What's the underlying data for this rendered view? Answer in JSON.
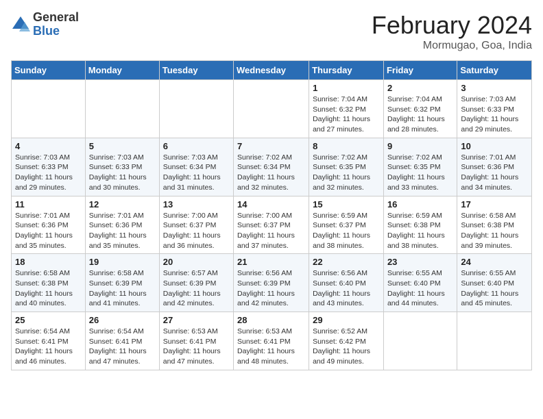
{
  "header": {
    "logo_general": "General",
    "logo_blue": "Blue",
    "title": "February 2024",
    "subtitle": "Mormugao, Goa, India"
  },
  "days_of_week": [
    "Sunday",
    "Monday",
    "Tuesday",
    "Wednesday",
    "Thursday",
    "Friday",
    "Saturday"
  ],
  "weeks": [
    [
      {
        "day": "",
        "info": ""
      },
      {
        "day": "",
        "info": ""
      },
      {
        "day": "",
        "info": ""
      },
      {
        "day": "",
        "info": ""
      },
      {
        "day": "1",
        "info": "Sunrise: 7:04 AM\nSunset: 6:32 PM\nDaylight: 11 hours and 27 minutes."
      },
      {
        "day": "2",
        "info": "Sunrise: 7:04 AM\nSunset: 6:32 PM\nDaylight: 11 hours and 28 minutes."
      },
      {
        "day": "3",
        "info": "Sunrise: 7:03 AM\nSunset: 6:33 PM\nDaylight: 11 hours and 29 minutes."
      }
    ],
    [
      {
        "day": "4",
        "info": "Sunrise: 7:03 AM\nSunset: 6:33 PM\nDaylight: 11 hours and 29 minutes."
      },
      {
        "day": "5",
        "info": "Sunrise: 7:03 AM\nSunset: 6:33 PM\nDaylight: 11 hours and 30 minutes."
      },
      {
        "day": "6",
        "info": "Sunrise: 7:03 AM\nSunset: 6:34 PM\nDaylight: 11 hours and 31 minutes."
      },
      {
        "day": "7",
        "info": "Sunrise: 7:02 AM\nSunset: 6:34 PM\nDaylight: 11 hours and 32 minutes."
      },
      {
        "day": "8",
        "info": "Sunrise: 7:02 AM\nSunset: 6:35 PM\nDaylight: 11 hours and 32 minutes."
      },
      {
        "day": "9",
        "info": "Sunrise: 7:02 AM\nSunset: 6:35 PM\nDaylight: 11 hours and 33 minutes."
      },
      {
        "day": "10",
        "info": "Sunrise: 7:01 AM\nSunset: 6:36 PM\nDaylight: 11 hours and 34 minutes."
      }
    ],
    [
      {
        "day": "11",
        "info": "Sunrise: 7:01 AM\nSunset: 6:36 PM\nDaylight: 11 hours and 35 minutes."
      },
      {
        "day": "12",
        "info": "Sunrise: 7:01 AM\nSunset: 6:36 PM\nDaylight: 11 hours and 35 minutes."
      },
      {
        "day": "13",
        "info": "Sunrise: 7:00 AM\nSunset: 6:37 PM\nDaylight: 11 hours and 36 minutes."
      },
      {
        "day": "14",
        "info": "Sunrise: 7:00 AM\nSunset: 6:37 PM\nDaylight: 11 hours and 37 minutes."
      },
      {
        "day": "15",
        "info": "Sunrise: 6:59 AM\nSunset: 6:37 PM\nDaylight: 11 hours and 38 minutes."
      },
      {
        "day": "16",
        "info": "Sunrise: 6:59 AM\nSunset: 6:38 PM\nDaylight: 11 hours and 38 minutes."
      },
      {
        "day": "17",
        "info": "Sunrise: 6:58 AM\nSunset: 6:38 PM\nDaylight: 11 hours and 39 minutes."
      }
    ],
    [
      {
        "day": "18",
        "info": "Sunrise: 6:58 AM\nSunset: 6:38 PM\nDaylight: 11 hours and 40 minutes."
      },
      {
        "day": "19",
        "info": "Sunrise: 6:58 AM\nSunset: 6:39 PM\nDaylight: 11 hours and 41 minutes."
      },
      {
        "day": "20",
        "info": "Sunrise: 6:57 AM\nSunset: 6:39 PM\nDaylight: 11 hours and 42 minutes."
      },
      {
        "day": "21",
        "info": "Sunrise: 6:56 AM\nSunset: 6:39 PM\nDaylight: 11 hours and 42 minutes."
      },
      {
        "day": "22",
        "info": "Sunrise: 6:56 AM\nSunset: 6:40 PM\nDaylight: 11 hours and 43 minutes."
      },
      {
        "day": "23",
        "info": "Sunrise: 6:55 AM\nSunset: 6:40 PM\nDaylight: 11 hours and 44 minutes."
      },
      {
        "day": "24",
        "info": "Sunrise: 6:55 AM\nSunset: 6:40 PM\nDaylight: 11 hours and 45 minutes."
      }
    ],
    [
      {
        "day": "25",
        "info": "Sunrise: 6:54 AM\nSunset: 6:41 PM\nDaylight: 11 hours and 46 minutes."
      },
      {
        "day": "26",
        "info": "Sunrise: 6:54 AM\nSunset: 6:41 PM\nDaylight: 11 hours and 47 minutes."
      },
      {
        "day": "27",
        "info": "Sunrise: 6:53 AM\nSunset: 6:41 PM\nDaylight: 11 hours and 47 minutes."
      },
      {
        "day": "28",
        "info": "Sunrise: 6:53 AM\nSunset: 6:41 PM\nDaylight: 11 hours and 48 minutes."
      },
      {
        "day": "29",
        "info": "Sunrise: 6:52 AM\nSunset: 6:42 PM\nDaylight: 11 hours and 49 minutes."
      },
      {
        "day": "",
        "info": ""
      },
      {
        "day": "",
        "info": ""
      }
    ]
  ]
}
